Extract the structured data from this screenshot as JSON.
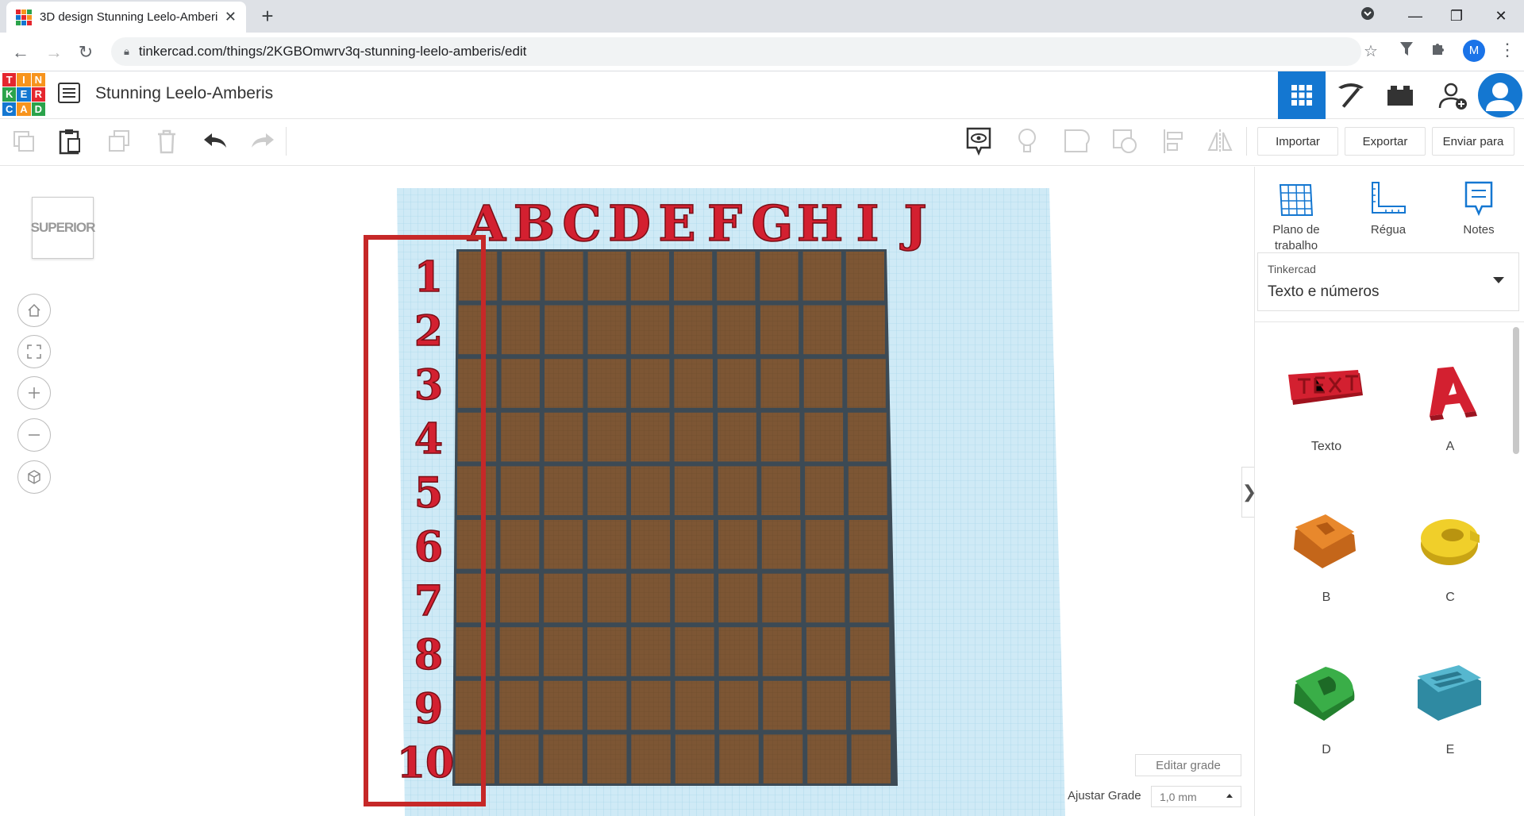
{
  "browser": {
    "tab_title": "3D design Stunning Leelo-Amberis",
    "tab_close": "✕",
    "new_tab": "+",
    "url": "tinkercad.com/things/2KGBOmwrv3q-stunning-leelo-amberis/edit",
    "profile_initial": "M"
  },
  "logo_letters": [
    "T",
    "I",
    "N",
    "K",
    "E",
    "R",
    "C",
    "A",
    "D"
  ],
  "logo_colors": [
    "#e5262e",
    "#f7941d",
    "#f7941d",
    "#2ba34b",
    "#1477d1",
    "#e5262e",
    "#1477d1",
    "#f7941d",
    "#2ba34b"
  ],
  "header": {
    "design_name": "Stunning Leelo-Amberis"
  },
  "toolbar": {
    "import_label": "Importar",
    "export_label": "Exportar",
    "send_label": "Enviar para"
  },
  "canvas": {
    "viewcube_label": "SUPERIOR",
    "column_letters": [
      "A",
      "B",
      "C",
      "D",
      "E",
      "F",
      "G",
      "H",
      "I",
      "J"
    ],
    "row_numbers": [
      "1",
      "2",
      "3",
      "4",
      "5",
      "6",
      "7",
      "8",
      "9",
      "10"
    ],
    "edit_grid_label": "Editar grade",
    "snap_grid_label": "Ajustar Grade",
    "snap_grid_value": "1,0 mm",
    "collapse_glyph": "❯"
  },
  "panel": {
    "workplane_label": "Plano de trabalho",
    "ruler_label": "Régua",
    "notes_label": "Notes",
    "library_source": "Tinkercad",
    "library_value": "Texto e números",
    "shapes": [
      {
        "label": "Texto",
        "color": "#d32030"
      },
      {
        "label": "A",
        "color": "#d32030"
      },
      {
        "label": "B",
        "color": "#e07a1f"
      },
      {
        "label": "C",
        "color": "#e6c21c"
      },
      {
        "label": "D",
        "color": "#2e9a3a"
      },
      {
        "label": "E",
        "color": "#3fa3bd"
      }
    ]
  },
  "colors": {
    "accent": "#1477d1",
    "selection": "#c62828",
    "grid_cell": "#7a5230",
    "workplane": "#bfe3f2",
    "letter_red": "#d32030"
  }
}
